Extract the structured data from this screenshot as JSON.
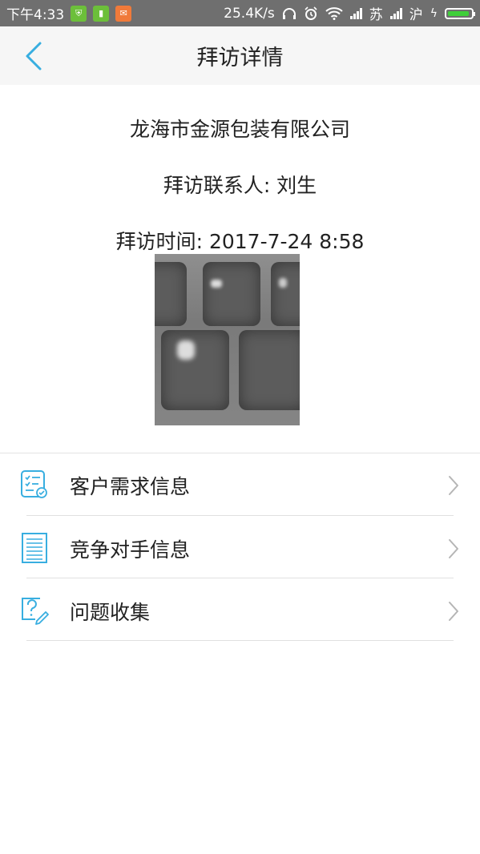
{
  "status_bar": {
    "time": "下午4:33",
    "speed": "25.4K/s",
    "carrier1": "苏",
    "carrier2": "沪"
  },
  "header": {
    "title": "拜访详情",
    "back_icon": "chevron-left-icon"
  },
  "visit": {
    "company": "龙海市金源包装有限公司",
    "contact": "拜访联系人: 刘生",
    "time": "拜访时间: 2017-7-24  8:58"
  },
  "menu": [
    {
      "label": "客户需求信息",
      "icon": "checklist-icon"
    },
    {
      "label": "竞争对手信息",
      "icon": "document-icon"
    },
    {
      "label": "问题收集",
      "icon": "question-edit-icon"
    }
  ],
  "colors": {
    "accent": "#38aee0",
    "header_bg": "#f6f6f6",
    "status_bg": "#6f6f6f"
  }
}
